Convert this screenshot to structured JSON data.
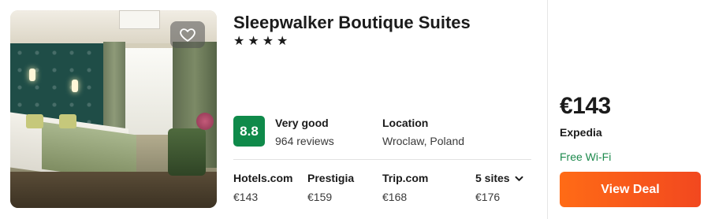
{
  "hotel": {
    "name": "Sleepwalker Boutique Suites",
    "stars": [
      "★",
      "★",
      "★",
      "★"
    ]
  },
  "rating": {
    "score": "8.8",
    "label": "Very good",
    "reviews": "964 reviews",
    "badge_color": "#0f8a4a"
  },
  "location": {
    "label": "Location",
    "value": "Wroclaw, Poland"
  },
  "sites": [
    {
      "name": "Hotels.com",
      "price": "€143"
    },
    {
      "name": "Prestigia",
      "price": "€159"
    },
    {
      "name": "Trip.com",
      "price": "€168"
    },
    {
      "name": "5 sites",
      "price": "€176"
    }
  ],
  "deal": {
    "price": "€143",
    "provider": "Expedia",
    "perk": "Free Wi-Fi",
    "button_label": "View Deal",
    "button_color": "#f2481f",
    "perk_color": "#1d8a4d"
  },
  "icons": {
    "favorite": "heart-icon",
    "more_sites": "chevron-down-icon"
  }
}
